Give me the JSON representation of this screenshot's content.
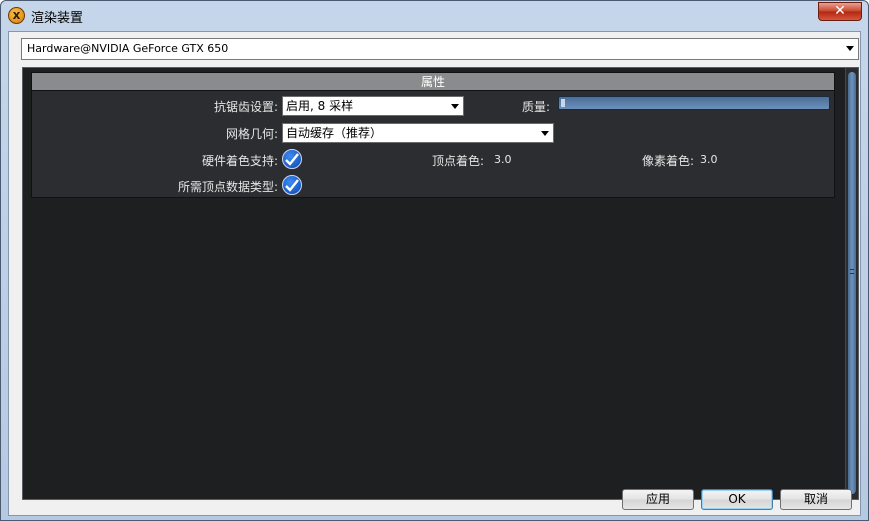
{
  "window": {
    "title": "渲染装置",
    "close_label": "✕"
  },
  "device_select": {
    "value": "Hardware@NVIDIA GeForce GTX 650"
  },
  "properties": {
    "header": "属性",
    "antialias": {
      "label": "抗锯齿设置:",
      "value": "启用, 8 采样"
    },
    "quality": {
      "label": "质量:",
      "level_fraction": 0.0
    },
    "mesh_geometry": {
      "label": "网格几何:",
      "value": "自动缓存（推荐）"
    },
    "hardware_shading": {
      "label": "硬件着色支持:",
      "checked": true
    },
    "vertex_shading": {
      "label": "顶点着色:",
      "value": "3.0"
    },
    "pixel_shading": {
      "label": "像素着色:",
      "value": "3.0"
    },
    "vertex_data_types": {
      "label": "所需顶点数据类型:",
      "checked": true
    }
  },
  "buttons": {
    "apply": "应用",
    "ok": "OK",
    "cancel": "取消"
  },
  "colors": {
    "panel_bg": "#1e1f21",
    "check_blue": "#1a5fd1",
    "header_gray": "#8a8b8d"
  }
}
